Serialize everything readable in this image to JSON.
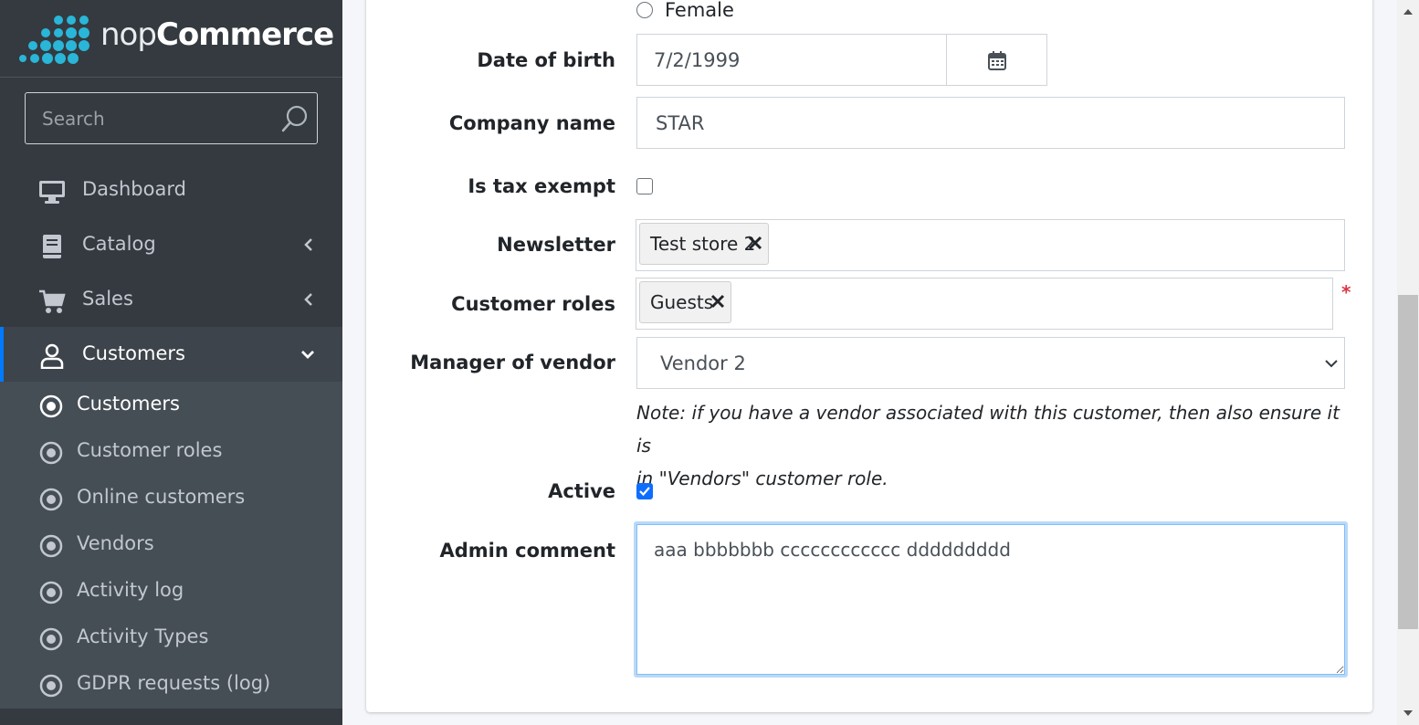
{
  "brand": {
    "name_part1": "nop",
    "name_part2": "Commerce"
  },
  "sidebar": {
    "search_placeholder": "Search",
    "nav": [
      {
        "label": "Dashboard",
        "icon": "desktop-icon"
      },
      {
        "label": "Catalog",
        "icon": "book-icon"
      },
      {
        "label": "Sales",
        "icon": "cart-icon"
      },
      {
        "label": "Customers",
        "icon": "user-icon"
      }
    ],
    "submenu": [
      {
        "label": "Customers"
      },
      {
        "label": "Customer roles"
      },
      {
        "label": "Online customers"
      },
      {
        "label": "Vendors"
      },
      {
        "label": "Activity log"
      },
      {
        "label": "Activity Types"
      },
      {
        "label": "GDPR requests (log)"
      }
    ]
  },
  "form": {
    "gender_female_label": "Female",
    "dob_label": "Date of birth",
    "dob_value": "7/2/1999",
    "company_label": "Company name",
    "company_value": "STAR",
    "tax_exempt_label": "Is tax exempt",
    "newsletter_label": "Newsletter",
    "newsletter_tag": "Test store 2",
    "roles_label": "Customer roles",
    "roles_tag": "Guests",
    "required_mark": "*",
    "vendor_label": "Manager of vendor",
    "vendor_value": "Vendor 2",
    "vendor_note_line1": "Note: if you have a vendor associated with this customer, then also ensure it is",
    "vendor_note_line2": "in \"Vendors\" customer role.",
    "active_label": "Active",
    "admin_comment_label": "Admin comment",
    "admin_comment_value": "aaa bbbbbbb cccccccccccc ddddddddd"
  },
  "colors": {
    "sidebar_bg": "#343a40",
    "submenu_bg": "#454d55",
    "accent": "#007bff",
    "brand_dots": "#29b6d8",
    "required": "#dc3545",
    "focus_border": "#80bdff"
  }
}
